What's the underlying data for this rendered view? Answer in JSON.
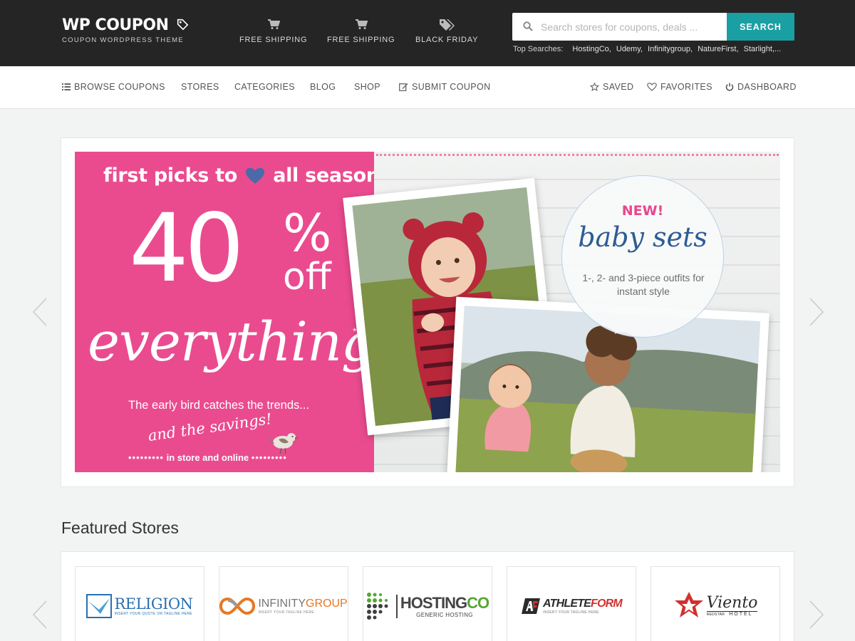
{
  "header": {
    "logo_title": "WP COUPON",
    "logo_subtitle": "COUPON WORDPRESS THEME",
    "quick_links": [
      {
        "label": "FREE SHIPPING",
        "icon": "cart-icon"
      },
      {
        "label": "FREE SHIPPING",
        "icon": "cart-icon"
      },
      {
        "label": "BLACK FRIDAY",
        "icon": "tags-icon"
      }
    ],
    "search": {
      "placeholder": "Search stores for coupons, deals ...",
      "button_label": "SEARCH"
    },
    "top_searches": {
      "label": "Top Searches:",
      "items": [
        "HostingCo,",
        "Udemy,",
        "Infinitygroup,",
        "NatureFirst,",
        "Starlight,..."
      ]
    }
  },
  "nav": {
    "left": [
      {
        "label": "BROWSE COUPONS",
        "icon": "list-icon"
      },
      {
        "label": "STORES"
      },
      {
        "label": "CATEGORIES"
      },
      {
        "label": "BLOG"
      },
      {
        "label": "SHOP"
      },
      {
        "label": "SUBMIT COUPON",
        "icon": "edit-icon"
      }
    ],
    "right": [
      {
        "label": "SAVED",
        "icon": "star-icon"
      },
      {
        "label": "FAVORITES",
        "icon": "heart-icon"
      },
      {
        "label": "DASHBOARD",
        "icon": "power-icon"
      }
    ]
  },
  "hero": {
    "headline_a": "first picks to",
    "headline_b": "all season",
    "big_number": "40",
    "percent": "%",
    "off": "off",
    "script": "everything",
    "asterisk": "*",
    "trend": "The early bird catches the trends...",
    "savings": "and the savings!",
    "online": "in store and online",
    "online_dots": "•••••••••",
    "new_label": "NEW!",
    "sets_label": "baby sets",
    "sets_desc": "1-, 2- and 3-piece outfits for instant style"
  },
  "featured": {
    "title": "Featured Stores",
    "stores": [
      {
        "name": "RELIGION",
        "tagline": "INSERT YOUR QUOTE OR TAGLINE HERE",
        "color": "#2a6fb0"
      },
      {
        "name": "INFINITY",
        "name2": "GROUP",
        "tagline": "INSERT YOUR TAGLINE HERE",
        "color": "#e87722"
      },
      {
        "name": "HOSTING",
        "name2": "CO",
        "tagline": "GENERIC HOSTING",
        "color": "#55a630"
      },
      {
        "name": "ATHLETE",
        "name2": "FORM",
        "tagline": "INSERT YOUR TAGLINE HERE",
        "color": "#d32f2f"
      },
      {
        "name": "Viento",
        "tagline": "HOTEL",
        "sub2": "REDSTAR",
        "color": "#d32f2f"
      }
    ]
  },
  "colors": {
    "header_bg": "#252525",
    "accent": "#1a9fa3",
    "promo_pink": "#ea4b8f"
  }
}
